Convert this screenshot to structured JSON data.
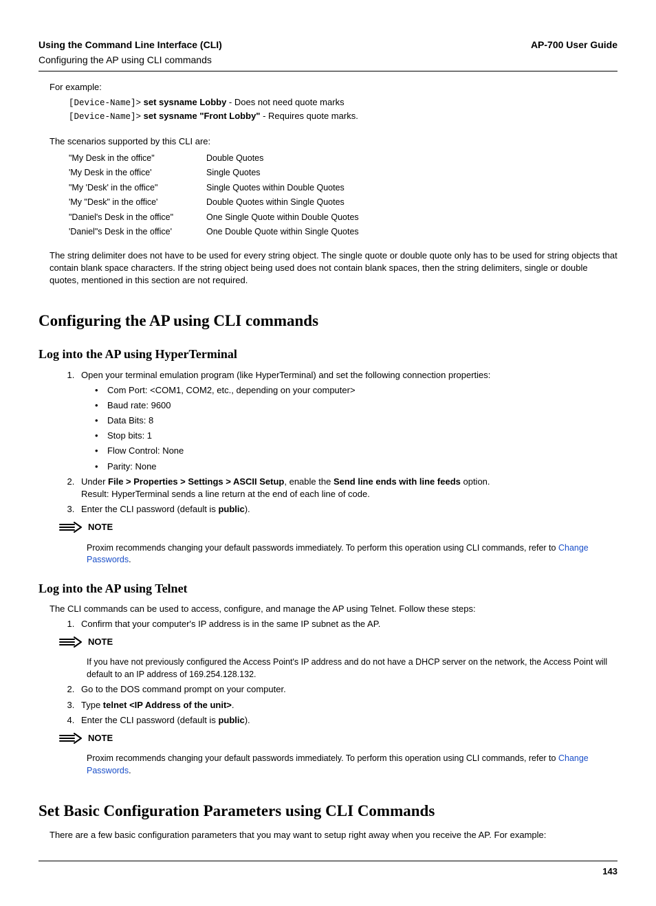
{
  "header": {
    "left": "Using the Command Line Interface (CLI)",
    "right": "AP-700 User Guide",
    "sub": "Configuring the AP using CLI commands"
  },
  "intro": {
    "for_example": "For example:",
    "ex1_prompt": "[Device-Name]>",
    "ex1_cmd": "set sysname Lobby",
    "ex1_desc": " - Does not need quote marks",
    "ex2_prompt": "[Device-Name]>",
    "ex2_cmd": "set sysname \"Front Lobby\"",
    "ex2_desc": " - Requires quote marks.",
    "scenarios_lead": "The scenarios supported by this CLI are:"
  },
  "quotes": [
    {
      "c1": "\"My Desk in the office\"",
      "c2": "Double Quotes"
    },
    {
      "c1": "'My Desk in the office'",
      "c2": "Single Quotes"
    },
    {
      "c1": "\"My 'Desk' in the office\"",
      "c2": "Single Quotes within Double Quotes"
    },
    {
      "c1": "'My \"Desk\" in the office'",
      "c2": "Double Quotes within Single Quotes"
    },
    {
      "c1": "\"Daniel's Desk in the office\"",
      "c2": "One Single Quote within Double Quotes"
    },
    {
      "c1": "'Daniel\"s Desk in the office'",
      "c2": "One Double Quote within Single Quotes"
    }
  ],
  "delimiter_para": "The string delimiter does not have to be used for every string object. The single quote or double quote only has to be used for string objects that contain blank space characters. If the string object being used does not contain blank spaces, then the string delimiters, single or double quotes, mentioned in this section are not required.",
  "h1_config": "Configuring the AP using CLI commands",
  "h2_hyper": "Log into the AP using HyperTerminal",
  "hyper": {
    "step1": "Open your terminal emulation program (like HyperTerminal) and set the following connection properties:",
    "bullets": [
      "Com Port: <COM1, COM2, etc., depending on your computer>",
      "Baud rate: 9600",
      "Data Bits: 8",
      "Stop bits: 1",
      "Flow Control: None",
      "Parity: None"
    ],
    "step2_a": "Under ",
    "step2_b": "File > Properties > Settings > ASCII Setup",
    "step2_c": ", enable the ",
    "step2_d": "Send line ends with line feeds",
    "step2_e": " option.",
    "step2_result": "Result: HyperTerminal sends a line return at the end of each line of code.",
    "step3_a": "Enter the CLI password (default is ",
    "step3_b": "public",
    "step3_c": ")."
  },
  "note_label": "NOTE",
  "note1_a": "Proxim recommends changing your default passwords immediately. To perform this operation using CLI commands, refer to ",
  "note1_link": "Change Passwords",
  "note1_b": ".",
  "h2_telnet": "Log into the AP using Telnet",
  "telnet": {
    "intro": "The CLI commands can be used to access, configure, and manage the AP using Telnet. Follow these steps:",
    "step1": "Confirm that your computer's IP address is in the same IP subnet as the AP."
  },
  "note2": "If you have not previously configured the Access Point's IP address and do not have a DHCP server on the network, the Access Point will default to an IP address of 169.254.128.132.",
  "telnet2": {
    "step2": "Go to the DOS command prompt on your computer.",
    "step3_a": "Type ",
    "step3_b": "telnet <IP Address of the unit>",
    "step3_c": ".",
    "step4_a": "Enter the CLI password (default is ",
    "step4_b": "public",
    "step4_c": ")."
  },
  "note3_a": "Proxim recommends changing your default passwords immediately. To perform this operation using CLI commands, refer to ",
  "note3_link": "Change Passwords",
  "note3_b": ".",
  "h1_basic": "Set Basic Configuration Parameters using CLI Commands",
  "basic_para": "There are a few basic configuration parameters that you may want to setup right away when you receive the AP. For example:",
  "page_num": "143"
}
